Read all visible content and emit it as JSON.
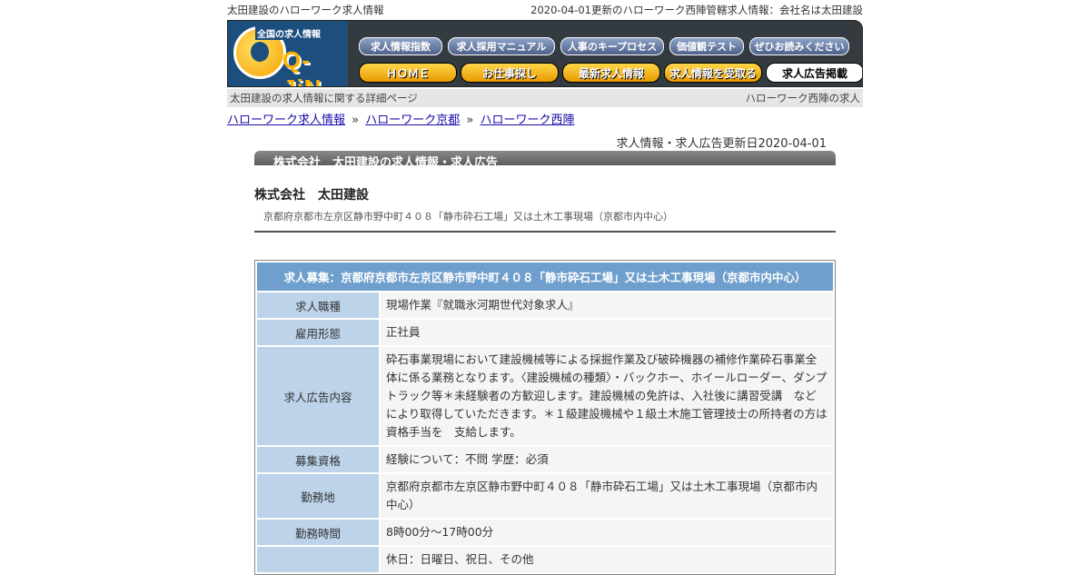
{
  "top": {
    "left": "太田建設のハローワーク求人情報",
    "right": "2020-04-01更新のハローワーク西陣管轄求人情報：会社名は太田建設"
  },
  "logo": {
    "tagline": "全国の求人情報",
    "wordmark": "Q-JiN"
  },
  "nav_top": [
    "求人情報指数",
    "求人採用マニュアル",
    "人事のキープロセス",
    "価値観テスト",
    "ぜひお読みください"
  ],
  "nav_main": [
    "ＨＯＭＥ",
    "お仕事探し",
    "最新求人情報",
    "求人情報を受取る",
    "求人広告掲載"
  ],
  "subbar": {
    "left": "太田建設の求人情報に関する詳細ページ",
    "right": "ハローワーク西陣の求人"
  },
  "breadcrumb": [
    "ハローワーク求人情報",
    "ハローワーク京都",
    "ハローワーク西陣"
  ],
  "updated": "求人情報・求人広告更新日2020-04-01",
  "section_title": "株式会社　太田建設の求人情報・求人広告",
  "company": "株式会社　太田建設",
  "address": "京都府京都市左京区静市野中町４０８「静市砕石工場」又は土木工事現場（京都市内中心）",
  "table": {
    "header": "求人募集：京都府京都市左京区静市野中町４０８「静市砕石工場」又は土木工事現場（京都市内中心）",
    "rows": [
      {
        "k": "求人職種",
        "v": "現場作業『就職氷河期世代対象求人』"
      },
      {
        "k": "雇用形態",
        "v": "正社員"
      },
      {
        "k": "求人広告内容",
        "v": "砕石事業現場において建設機械等による採掘作業及び破砕機器の補修作業砕石事業全体に係る業務となります。〈建設機械の種類〉・バックホー、ホイールローダー、ダンプトラック等＊未経験者の方歓迎します。建設機械の免許は、入社後に講習受講　などにより取得していただきます。＊１級建設機械や１級土木施工管理技士の所持者の方は資格手当を　支給します。"
      },
      {
        "k": "募集資格",
        "v": " 経験について：不問 学歴：必須"
      },
      {
        "k": "勤務地",
        "v": "京都府京都市左京区静市野中町４０８「静市砕石工場」又は土木工事現場（京都市内中心）"
      },
      {
        "k": "勤務時間",
        "v": "8時00分～17時00分"
      },
      {
        "k": "",
        "v": "休日：日曜日、祝日、その他"
      }
    ]
  }
}
